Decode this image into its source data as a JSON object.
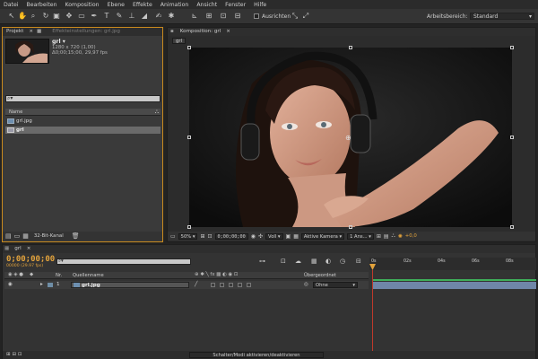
{
  "menu": [
    "Datei",
    "Bearbeiten",
    "Komposition",
    "Ebene",
    "Effekte",
    "Animation",
    "Ansicht",
    "Fenster",
    "Hilfe"
  ],
  "toolbar": {
    "align_label": "Ausrichten",
    "workspace_label": "Arbeitsbereich:",
    "workspace_value": "Standard"
  },
  "project_panel": {
    "tab_project": "Projekt",
    "tab_effect_controls": "Effekteinstellungen: grl.jpg",
    "item_name": "grl",
    "item_dims": "1280 x 720 (1,00)",
    "item_duration": "Δ0;00;15;00, 29,97 fps",
    "search_placeholder": "",
    "column_name": "Name",
    "items": [
      {
        "name": "grl.jpg",
        "type": "image"
      },
      {
        "name": "grl",
        "type": "composition"
      }
    ],
    "bit_depth": "32-Bit-Kanal"
  },
  "composition_panel": {
    "tab_label": "Komposition: grl",
    "breadcrumb": "grl",
    "zoom": "50%",
    "timecode": "0;00;00;00",
    "resolution": "Voll",
    "camera": "Aktive Kamera",
    "views": "1 Ans...",
    "exposure": "+0,0"
  },
  "timeline": {
    "tab_label": "grl",
    "current_time": "0;00;00;00",
    "frame_info": "00000 (29.97 fps)",
    "search_placeholder": "",
    "col_nr": "Nr.",
    "col_source": "Quellenname",
    "col_parent": "Übergeordnet",
    "layer_number": "1",
    "layer_name": "grl.jpg",
    "parent_value": "Ohne",
    "ruler": [
      "0s",
      "02s",
      "04s",
      "06s",
      "08s"
    ],
    "toggle_label": "Schalter/Modi aktivieren/deaktivieren"
  },
  "colors": {
    "accent_orange": "#e3a33c",
    "track_green": "#3fae5a",
    "selection": "#6a6a6a"
  }
}
